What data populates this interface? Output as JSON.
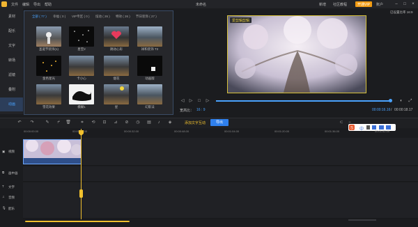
{
  "app": {
    "menu": [
      "文件",
      "编辑",
      "导出",
      "帮助"
    ],
    "title": "未命名",
    "links": [
      "新增",
      "社区教程"
    ],
    "vip_label": "开通VIP",
    "user_label": "账户",
    "window_buttons": [
      "minimize-icon",
      "maximize-icon",
      "close-icon"
    ]
  },
  "sidebar": {
    "items": [
      {
        "label": "素材"
      },
      {
        "label": "配乐"
      },
      {
        "label": "文字"
      },
      {
        "label": "转场"
      },
      {
        "label": "滤镜"
      },
      {
        "label": "叠附"
      },
      {
        "label": "动画"
      }
    ],
    "active_index": 6
  },
  "media_panel": {
    "tabs": [
      "全部 ( 77 )",
      "幸福 ( 0 )",
      "VIP专区 ( 0 )",
      "炫动 ( 26 )",
      "特效 ( 26 )",
      "节日装饰 ( 27 )"
    ],
    "active_tab": 0,
    "thumbs": [
      {
        "label": "圣诞节装饰(1)"
      },
      {
        "label": "星空2"
      },
      {
        "label": "跳动心形"
      },
      {
        "label": "祥和装饰 T2"
      },
      {
        "label": "金色星光"
      },
      {
        "label": "卡小心"
      },
      {
        "label": "烟花"
      },
      {
        "label": "动画版"
      },
      {
        "label": "雪花效果"
      },
      {
        "label": "模糊1"
      },
      {
        "label": "星"
      },
      {
        "label": "幻影法"
      }
    ]
  },
  "preview": {
    "badge": "爱剪辑剪辑",
    "ratio_tag": "已设置比率 16:9",
    "ratio_label": "宽高比：",
    "ratio_value": "16 : 9",
    "current_time": "00:00:16.16",
    "total_time": "00:00:18.17",
    "progress_fraction": 0.99
  },
  "toolbar": {
    "add_text_label": "添加文字互动",
    "export_label": "导出"
  },
  "timeline": {
    "ruler_ticks": [
      "00:00:00.00",
      "00:00:16.00",
      "00:00:32.00",
      "00:00:48.00",
      "00:01:04.00",
      "00:01:20.00",
      "00:01:36.00",
      "00:01:52.00"
    ],
    "tracks": [
      {
        "label": "视频"
      },
      {
        "label": "画中画"
      },
      {
        "label": "文字"
      },
      {
        "label": "音频"
      },
      {
        "label": "配乐"
      }
    ],
    "ime_text": "中"
  }
}
